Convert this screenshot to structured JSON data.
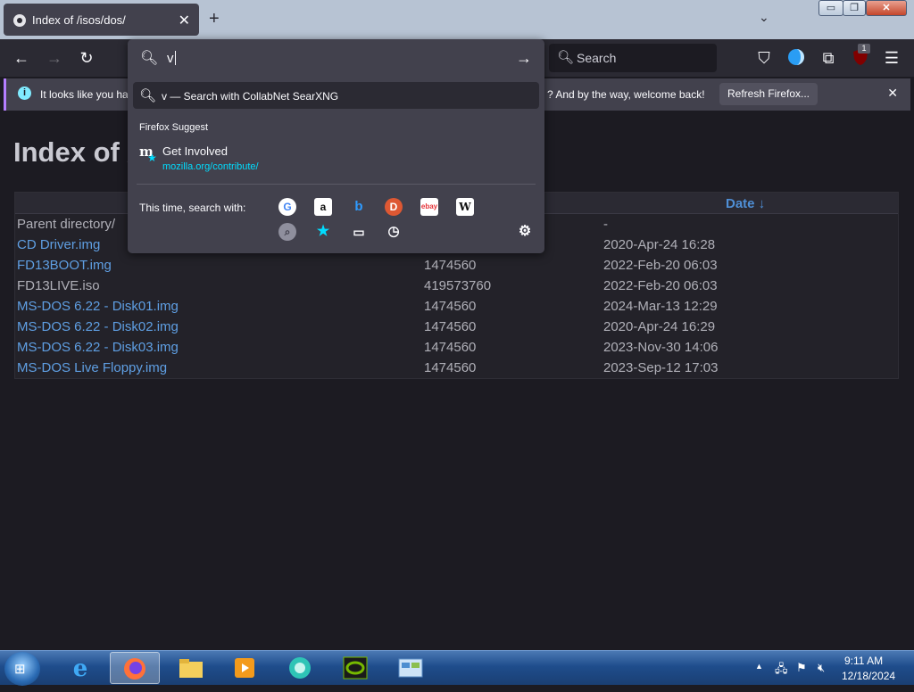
{
  "tab": {
    "title": "Index of /isos/dos/",
    "close": "✕"
  },
  "tabstrip": {
    "new_tab": "+",
    "tab_list": "⌄"
  },
  "window_controls": {
    "minimize": "▭",
    "maximize": "❐",
    "close": "✕"
  },
  "navbar": {
    "search_placeholder": "Search",
    "ublock_badge": "1"
  },
  "notification": {
    "text_left": "It looks like you ha",
    "text_right": "? And by the way, welcome back!",
    "button": "Refresh Firefox...",
    "close": "✕"
  },
  "urlbar": {
    "value": "v",
    "search_suggestion": "v — Search with CollabNet SearXNG",
    "firefox_suggest_header": "Firefox Suggest",
    "suggest_item": {
      "title": "Get Involved",
      "url": "mozilla.org/contribute/"
    },
    "engine_label": "This time, search with:"
  },
  "page": {
    "title": "Index of /isos/dos/",
    "date_header": "Date ↓",
    "rows": [
      {
        "name": "Parent directory/",
        "size": "",
        "date": "-",
        "link": false
      },
      {
        "name": "CD Driver.img",
        "size": "",
        "date": "2020-Apr-24 16:28",
        "link": true
      },
      {
        "name": "FD13BOOT.img",
        "size": "1474560",
        "date": "2022-Feb-20 06:03",
        "link": true
      },
      {
        "name": "FD13LIVE.iso",
        "size": "419573760",
        "date": "2022-Feb-20 06:03",
        "link": false
      },
      {
        "name": "MS-DOS 6.22 - Disk01.img",
        "size": "1474560",
        "date": "2024-Mar-13 12:29",
        "link": true
      },
      {
        "name": "MS-DOS 6.22 - Disk02.img",
        "size": "1474560",
        "date": "2020-Apr-24 16:29",
        "link": true
      },
      {
        "name": "MS-DOS 6.22 - Disk03.img",
        "size": "1474560",
        "date": "2023-Nov-30 14:06",
        "link": true
      },
      {
        "name": "MS-DOS Live Floppy.img",
        "size": "1474560",
        "date": "2023-Sep-12 17:03",
        "link": true
      }
    ]
  },
  "taskbar": {
    "time": "9:11 AM",
    "date": "12/18/2024"
  },
  "colors": {
    "accent": "#00ddff",
    "link": "#5f9fe3",
    "notification_border": "#b57fff"
  }
}
